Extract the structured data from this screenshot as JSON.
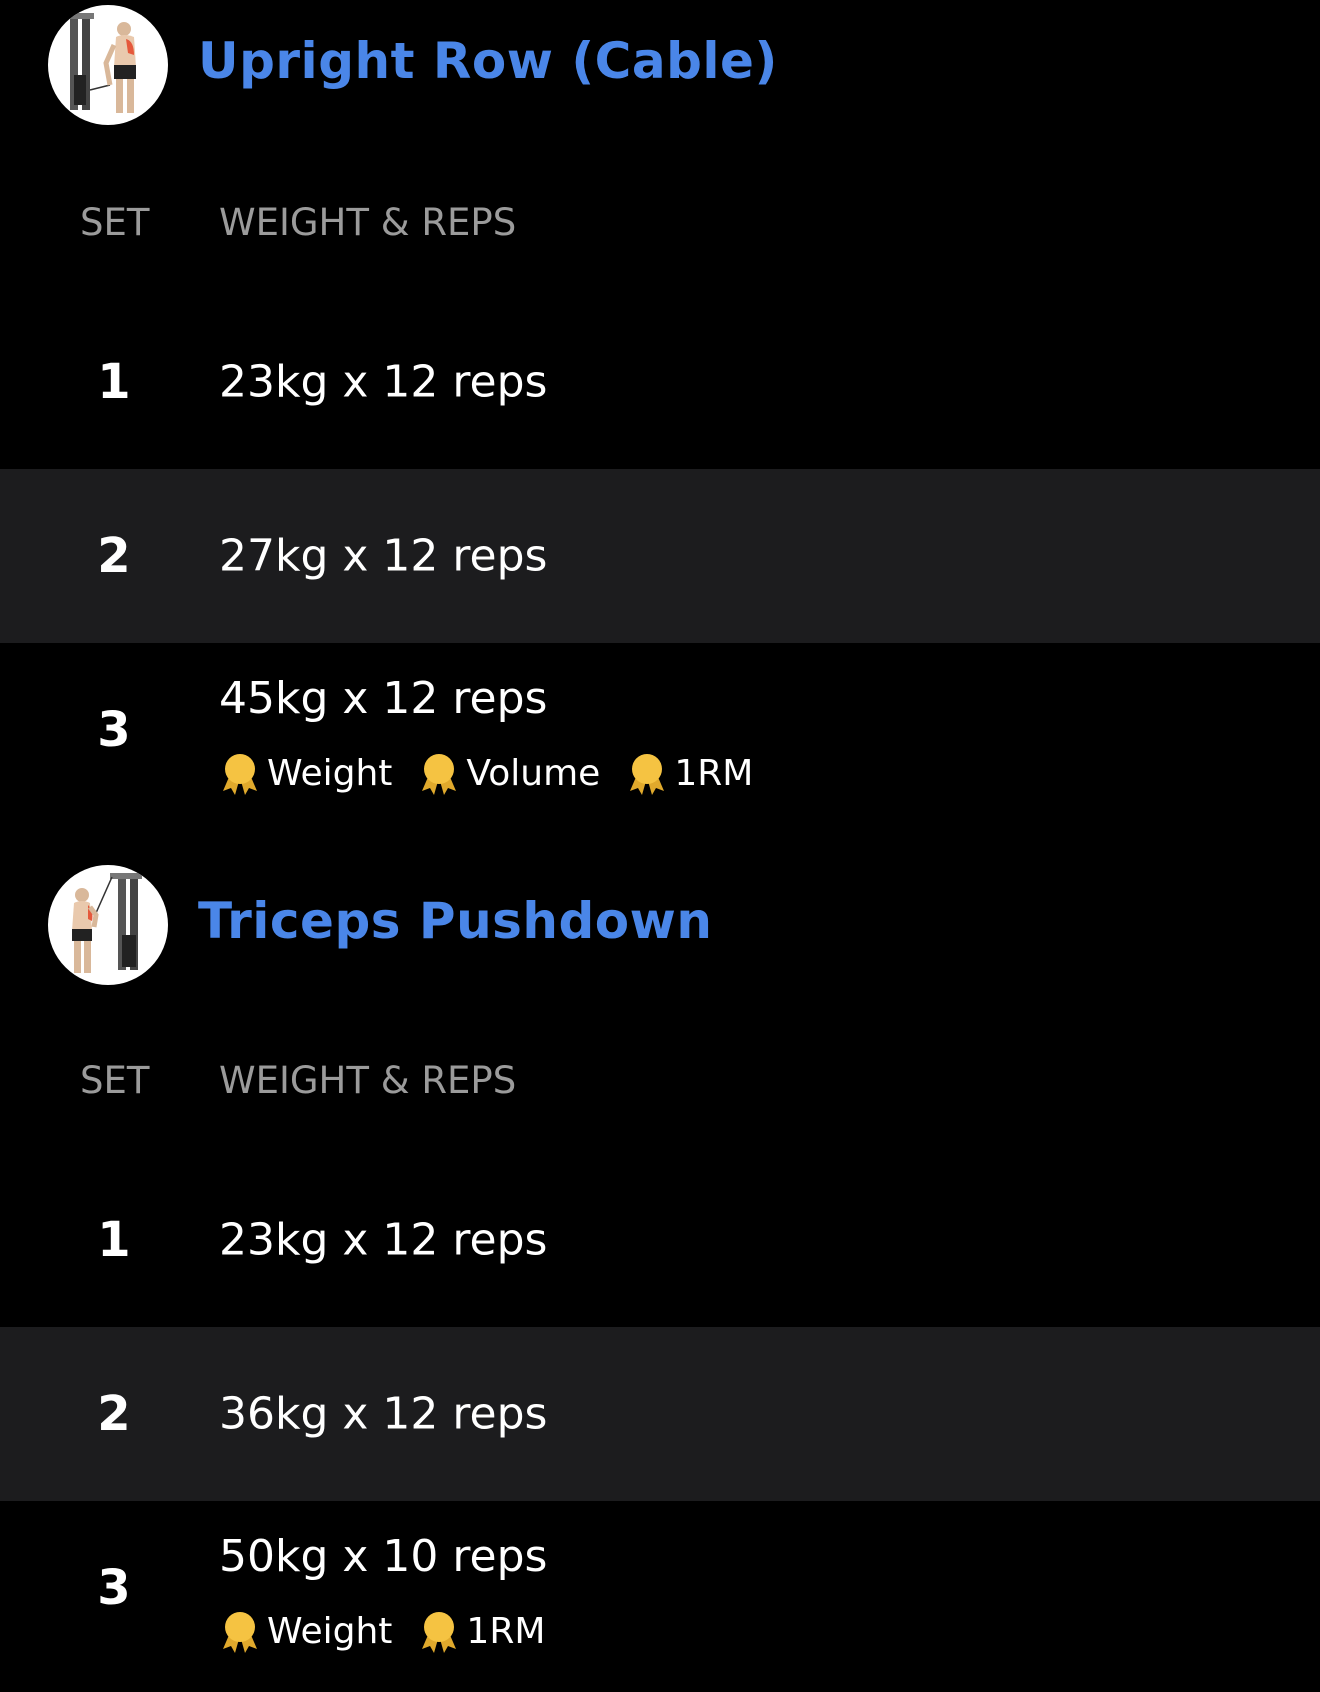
{
  "colors": {
    "background": "#000000",
    "row_alt": "#1c1c1e",
    "title": "#4a86e8",
    "header_text": "#9b9b9b",
    "medal": "#f5c342"
  },
  "exercises": [
    {
      "title": "Upright Row (Cable)",
      "thumbnail_icon": "cable-upright-row-illustration",
      "columns": {
        "set": "SET",
        "weight_reps": "WEIGHT & REPS"
      },
      "sets": [
        {
          "number": "1",
          "value": "23kg x 12 reps",
          "badges": []
        },
        {
          "number": "2",
          "value": "27kg x 12 reps",
          "badges": []
        },
        {
          "number": "3",
          "value": "45kg x 12 reps",
          "badges": [
            "Weight",
            "Volume",
            "1RM"
          ]
        }
      ]
    },
    {
      "title": "Triceps Pushdown",
      "thumbnail_icon": "triceps-pushdown-illustration",
      "columns": {
        "set": "SET",
        "weight_reps": "WEIGHT & REPS"
      },
      "sets": [
        {
          "number": "1",
          "value": "23kg x 12 reps",
          "badges": []
        },
        {
          "number": "2",
          "value": "36kg x 12 reps",
          "badges": []
        },
        {
          "number": "3",
          "value": "50kg x 10 reps",
          "badges": [
            "Weight",
            "1RM"
          ]
        }
      ]
    }
  ]
}
